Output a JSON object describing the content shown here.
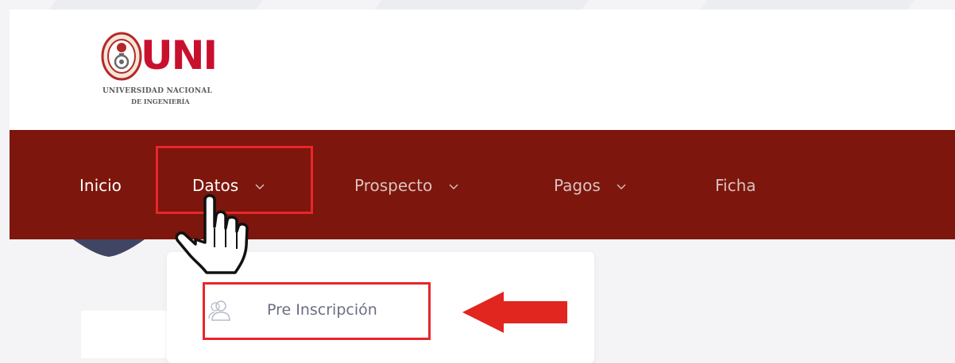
{
  "logo": {
    "brand": "UNI",
    "line1": "UNIVERSIDAD NACIONAL",
    "line2": "DE INGENIERÍA"
  },
  "nav": {
    "items": [
      {
        "label": "Inicio",
        "has_dropdown": false
      },
      {
        "label": "Datos",
        "has_dropdown": true
      },
      {
        "label": "Prospecto",
        "has_dropdown": true
      },
      {
        "label": "Pagos",
        "has_dropdown": true
      },
      {
        "label": "Ficha",
        "has_dropdown": false
      }
    ]
  },
  "dropdown": {
    "items": [
      {
        "label": "Pre Inscripción",
        "icon": "users-icon"
      }
    ]
  },
  "colors": {
    "nav_background": "#7d160c",
    "highlight": "#e8262c",
    "brand_red": "#c8102e"
  }
}
